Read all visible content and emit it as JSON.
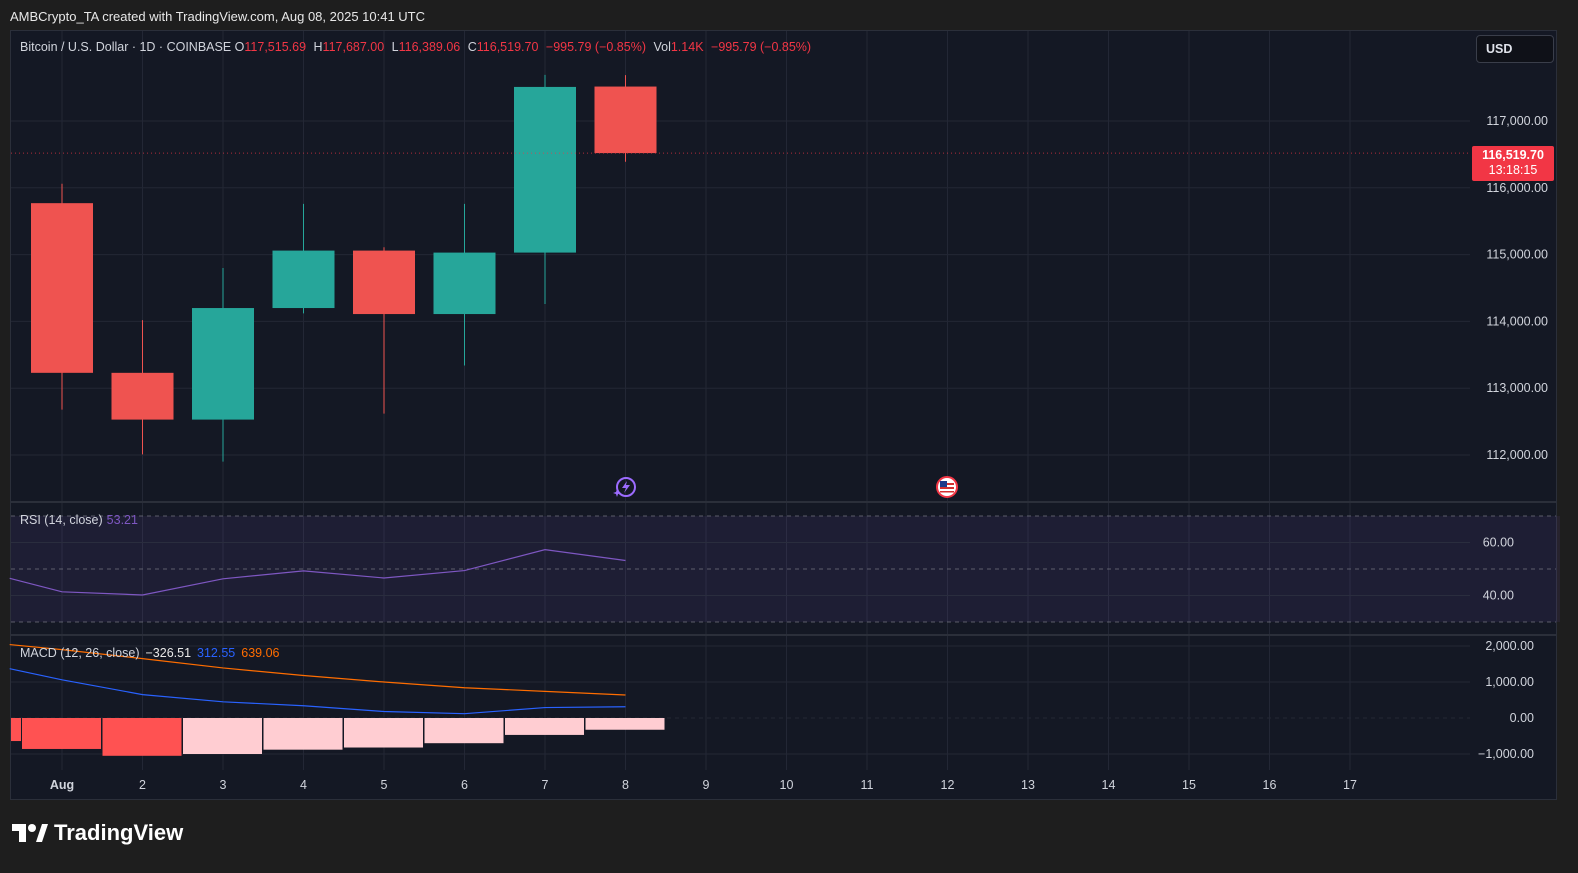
{
  "credit": "AMBCrypto_TA created with TradingView.com, Aug 08, 2025 10:41 UTC",
  "legend": {
    "symbol": "Bitcoin / U.S. Dollar · 1D · COINBASE",
    "o_label": "O",
    "o_value": "117,515.69",
    "h_label": "H",
    "h_value": "117,687.00",
    "l_label": "L",
    "l_value": "116,389.06",
    "c_label": "C",
    "c_value": "116,519.70",
    "change": "−995.79 (−0.85%)",
    "vol_label": "Vol",
    "vol_value": "1.14K",
    "vol_change": "−995.79 (−0.85%)"
  },
  "currency_button": "USD",
  "price_tag": {
    "price": "116,519.70",
    "countdown": "13:18:15"
  },
  "rsi_legend": {
    "label": "RSI (14, close)",
    "value": "53.21"
  },
  "macd_legend": {
    "label": "MACD (12, 26, close)",
    "hist": "−326.51",
    "macd": "312.55",
    "signal": "639.06"
  },
  "brand": "TradingView",
  "colors": {
    "up": "#26a69a",
    "down": "#ef5350",
    "rsi": "#7e57c2",
    "macd": "#2962ff",
    "signal": "#ff6d00",
    "hist_strong": "#ff5252",
    "hist_weak": "#ffcdd2"
  },
  "icons": {
    "event_1": "lightning-icon",
    "event_2": "us-flag-icon"
  },
  "chart_data": [
    {
      "type": "candlestick",
      "title": "",
      "x_ticks": [
        "Aug",
        "2",
        "3",
        "4",
        "5",
        "6",
        "7",
        "8",
        "9",
        "10",
        "11",
        "12",
        "13",
        "14",
        "15",
        "16",
        "17"
      ],
      "y_ticks": [
        "112,000.00",
        "113,000.00",
        "114,000.00",
        "115,000.00",
        "116,000.00",
        "117,000.00"
      ],
      "ylim": [
        111300,
        118400
      ],
      "candles": [
        {
          "x": 1,
          "open": 115770,
          "high": 116060,
          "low": 112680,
          "close": 113230
        },
        {
          "x": 2,
          "open": 113230,
          "high": 114020,
          "low": 112010,
          "close": 112530
        },
        {
          "x": 3,
          "open": 112530,
          "high": 114800,
          "low": 111900,
          "close": 114200
        },
        {
          "x": 4,
          "open": 114200,
          "high": 115760,
          "low": 114120,
          "close": 115060
        },
        {
          "x": 5,
          "open": 115060,
          "high": 115110,
          "low": 112620,
          "close": 114110
        },
        {
          "x": 6,
          "open": 114110,
          "high": 115760,
          "low": 113340,
          "close": 115030
        },
        {
          "x": 7,
          "open": 115030,
          "high": 117690,
          "low": 114260,
          "close": 117510
        },
        {
          "x": 8,
          "open": 117515.69,
          "high": 117687.0,
          "low": 116389.06,
          "close": 116519.7
        }
      ]
    },
    {
      "type": "line",
      "name": "RSI (14, close)",
      "y_ticks": [
        "40.00",
        "60.00"
      ],
      "ylim": [
        25,
        75
      ],
      "bands": [
        30,
        50,
        70
      ],
      "x": [
        0.35,
        1,
        2,
        3,
        4,
        5,
        6,
        7,
        8
      ],
      "values": [
        46.5,
        41.4,
        40.2,
        46.3,
        49.3,
        46.6,
        49.4,
        57.3,
        53.21
      ]
    },
    {
      "type": "line+bar",
      "name": "MACD (12, 26, close)",
      "y_ticks": [
        "2,000.00",
        "1,000.00",
        "0.00",
        "−1,000.00"
      ],
      "ylim": [
        -1300,
        2300
      ],
      "x": [
        0.35,
        1,
        2,
        3,
        4,
        5,
        6,
        7,
        8
      ],
      "macd": [
        1370,
        1060,
        650,
        450,
        340,
        180,
        120,
        290,
        312.55
      ],
      "signal": [
        2040,
        1900,
        1650,
        1390,
        1180,
        1000,
        840,
        740,
        639.06
      ],
      "histogram": {
        "x": [
          0.35,
          1,
          2,
          3,
          4,
          5,
          6,
          7,
          8
        ],
        "values": [
          -640,
          -860,
          -1050,
          -1000,
          -880,
          -820,
          -700,
          -470,
          -326.51
        ],
        "colors": [
          "strong",
          "strong",
          "strong",
          "weak",
          "weak",
          "weak",
          "weak",
          "weak",
          "weak"
        ]
      }
    }
  ]
}
